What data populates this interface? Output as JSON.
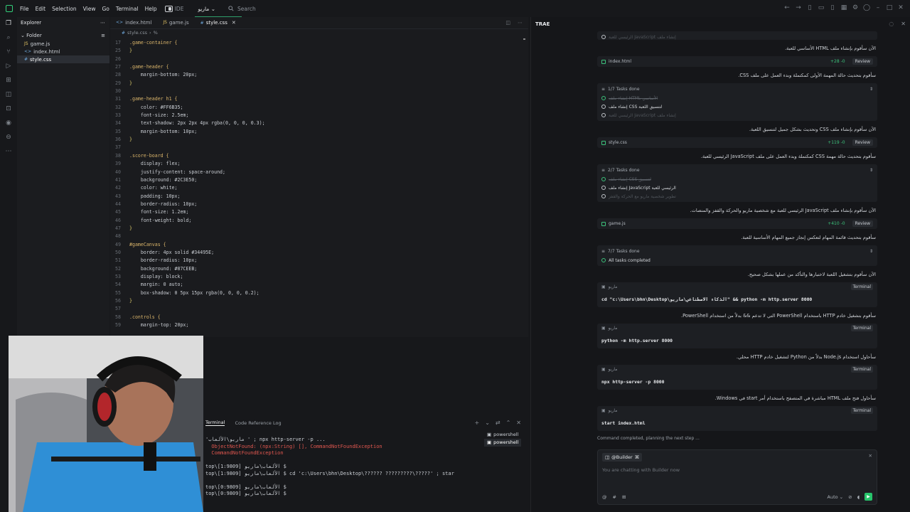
{
  "menu": [
    "File",
    "Edit",
    "Selection",
    "View",
    "Go",
    "Terminal",
    "Help"
  ],
  "ide_label": "IDE",
  "project_name": "ماريو",
  "search_placeholder": "Search",
  "explorer": {
    "title": "Explorer",
    "folder": "Folder",
    "files": [
      "game.js",
      "index.html",
      "style.css"
    ]
  },
  "tabs": [
    "index.html",
    "game.js",
    "style.css"
  ],
  "breadcrumb": "style.css",
  "code_lines": [
    {
      "n": "17",
      "t": ".game-container {"
    },
    {
      "n": "25",
      "t": "}"
    },
    {
      "n": "26",
      "t": ""
    },
    {
      "n": "27",
      "t": ".game-header {"
    },
    {
      "n": "28",
      "t": "    margin-bottom: 20px;"
    },
    {
      "n": "29",
      "t": "}"
    },
    {
      "n": "30",
      "t": ""
    },
    {
      "n": "31",
      "t": ".game-header h1 {"
    },
    {
      "n": "32",
      "t": "    color: #FF6B35;"
    },
    {
      "n": "33",
      "t": "    font-size: 2.5em;"
    },
    {
      "n": "34",
      "t": "    text-shadow: 2px 2px 4px rgba(0, 0, 0, 0.3);"
    },
    {
      "n": "35",
      "t": "    margin-bottom: 10px;"
    },
    {
      "n": "36",
      "t": "}"
    },
    {
      "n": "37",
      "t": ""
    },
    {
      "n": "38",
      "t": ".score-board {"
    },
    {
      "n": "39",
      "t": "    display: flex;"
    },
    {
      "n": "40",
      "t": "    justify-content: space-around;"
    },
    {
      "n": "41",
      "t": "    background: #2C3E50;"
    },
    {
      "n": "42",
      "t": "    color: white;"
    },
    {
      "n": "43",
      "t": "    padding: 10px;"
    },
    {
      "n": "44",
      "t": "    border-radius: 10px;"
    },
    {
      "n": "45",
      "t": "    font-size: 1.2em;"
    },
    {
      "n": "46",
      "t": "    font-weight: bold;"
    },
    {
      "n": "47",
      "t": "}"
    },
    {
      "n": "48",
      "t": ""
    },
    {
      "n": "49",
      "t": "#gameCanvas {"
    },
    {
      "n": "50",
      "t": "    border: 4px solid #34495E;"
    },
    {
      "n": "51",
      "t": "    border-radius: 10px;"
    },
    {
      "n": "52",
      "t": "    background: #87CEEB;"
    },
    {
      "n": "53",
      "t": "    display: block;"
    },
    {
      "n": "54",
      "t": "    margin: 0 auto;"
    },
    {
      "n": "55",
      "t": "    box-shadow: 0 5px 15px rgba(0, 0, 0, 0.2);"
    },
    {
      "n": "56",
      "t": "}"
    },
    {
      "n": "57",
      "t": ""
    },
    {
      "n": "58",
      "t": ".controls {"
    },
    {
      "n": "59",
      "t": "    margin-top: 20px;"
    }
  ],
  "terminal": {
    "tabs": [
      "Terminal",
      "Code Reference Log"
    ],
    "lines": [
      "'ماريو\\الألعاب ' ; npx http-server -p ...",
      "  ObjectNotFound: (npx:String) [], CommandNotFoundException",
      "  CommandNotFoundException",
      "",
      "top\\الألعاب\\ماريو [1:9809] $",
      "top\\الألعاب\\ماريو [1:9809] $ cd 'c:\\Users\\bhn\\Desktop\\?????? ?????????\\?????' ; star",
      "",
      "top\\الألعاب\\ماريو [0:9809] $",
      "top\\الألعاب\\ماريو [0:9809] $"
    ],
    "sessions": [
      "powershell",
      "powershell"
    ]
  },
  "ai": {
    "title": "TRAE",
    "input_agent": "@Builder",
    "input_placeholder": "You are chatting with Builder now",
    "mode": "Auto",
    "status": "Command completed, planning the next step ...",
    "messages": {
      "m0": "الرئيسي للعبة JavaScript إنشاء ملف",
      "m1": "الآن سأقوم بإنشاء ملف HTML الأساسي للعبة.",
      "m2": "سأقوم بتحديث حالة المهمة الأولى كمكتملة وبدء العمل على ملف CSS.",
      "m3": "الآن سأقوم بإنشاء ملف CSS وتحديث بشكل جميل لتنسيق اللعبة.",
      "m4": "سأقوم بتحديث حالة مهمة CSS كمكتملة وبدء العمل على ملف JavaScript الرئيسي للعبة.",
      "m5": "الآن سأقوم بإنشاء ملف JavaScript الرئيسي للعبة مع شخصية ماريو والحركة والقفز والمنصات.",
      "m6": "سأقوم بتحديث قائمة المهام لتعكس إنجاز جميع المهام الأساسية للعبة.",
      "m7": "الآن سأقوم بتشغيل اللعبة لاختبارها والتأكد من عملها بشكل صحيح.",
      "m8": "سأقوم بتشغيل خادم HTTP باستخدام PowerShell التي لا تدعم && بدلاً من استخدام PowerShell.",
      "m9": "سأحاول استخدام Node.js بدلاً من Python لتشغيل خادم HTTP محلي.",
      "m10": "سأحاول فتح ملف HTML مباشرة في المتصفح باستخدام أمر start في Windows."
    },
    "file_cards": [
      {
        "name": "index.html",
        "diff": "+28 -0",
        "action": "Review"
      },
      {
        "name": "style.css",
        "diff": "+119 -0",
        "action": "Review"
      },
      {
        "name": "game.js",
        "diff": "+410 -0",
        "action": "Review"
      }
    ],
    "task_cards": [
      {
        "header": "1/7 Tasks done",
        "items": [
          "إنشاء ملف HTML الأساسي",
          "إنشاء ملف CSS لتنسيق اللعبة",
          "الرئيسي للعبة JavaScript إنشاء ملف"
        ]
      },
      {
        "header": "2/7 Tasks done",
        "items": [
          "إنشاء ملف CSS لتنسيق",
          "إنشاء ملف JavaScript الرئيسي للعبة",
          "تطوير شخصية ماريو مع الحركة والقفز"
        ]
      },
      {
        "header": "7/7 Tasks done",
        "items": [
          "All tasks completed"
        ]
      }
    ],
    "cmd_cards": [
      {
        "label": "ماريو",
        "button": "Terminal",
        "cmd": "cd \"c:\\Users\\bhn\\Desktop\\الذكاء الاصطناعي\\ماريو\" && python -m http.server 8000"
      },
      {
        "label": "ماريو",
        "button": "Terminal",
        "cmd": "python -m http.server 8000"
      },
      {
        "label": "ماريو",
        "button": "Terminal",
        "cmd": "npx http-server -p 8000"
      },
      {
        "label": "ماريو",
        "button": "Terminal",
        "cmd": "start index.html"
      }
    ]
  }
}
